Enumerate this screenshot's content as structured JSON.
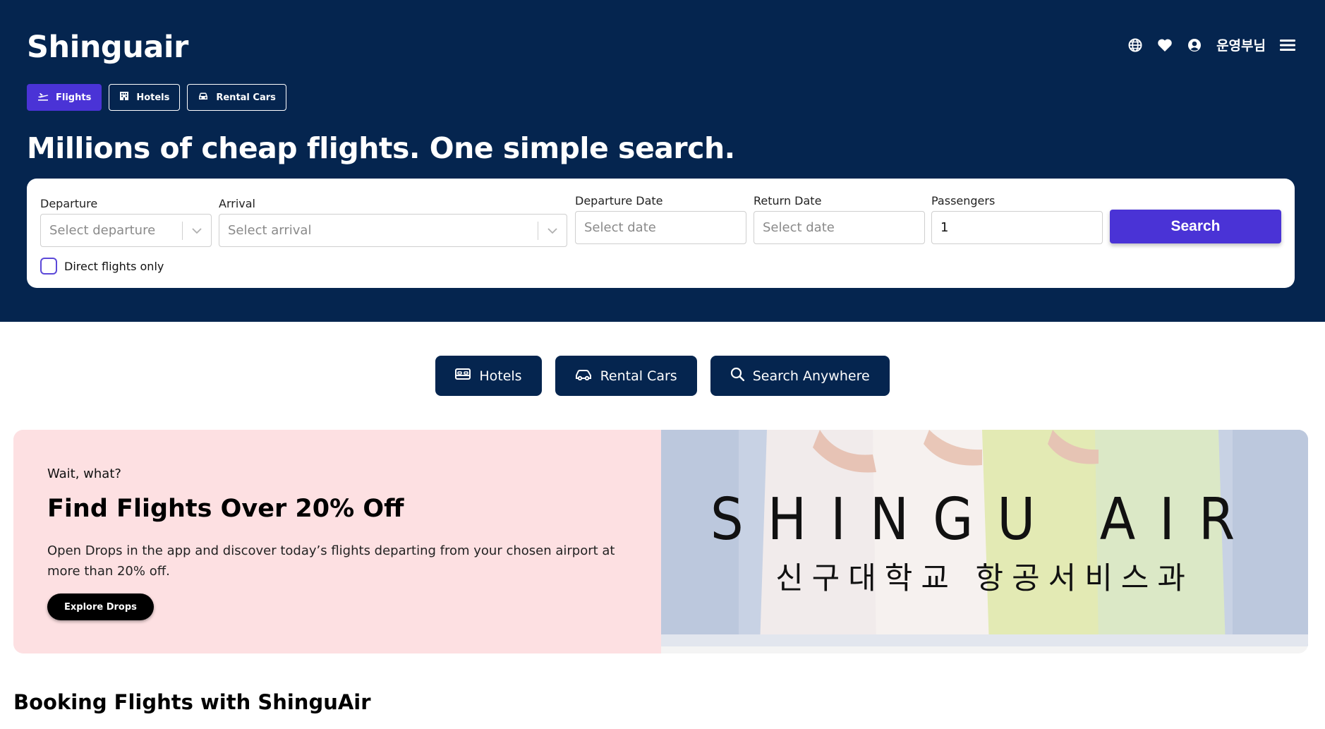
{
  "header": {
    "brand": "Shinguair",
    "user_name": "운영부님",
    "icons": [
      "globe-icon",
      "heart-icon",
      "user-circle-icon",
      "hamburger-menu-icon"
    ]
  },
  "mode_tabs": [
    {
      "label": "Flights",
      "icon": "plane-icon",
      "active": true
    },
    {
      "label": "Hotels",
      "icon": "building-icon",
      "active": false
    },
    {
      "label": "Rental Cars",
      "icon": "car-icon",
      "active": false
    }
  ],
  "headline": "Millions of cheap flights. One simple search.",
  "search": {
    "departure_label": "Departure",
    "departure_placeholder": "Select departure",
    "arrival_label": "Arrival",
    "arrival_placeholder": "Select arrival",
    "departure_date_label": "Departure Date",
    "departure_date_placeholder": "Select date",
    "return_date_label": "Return Date",
    "return_date_placeholder": "Select date",
    "passengers_label": "Passengers",
    "passengers_value": "1",
    "search_label": "Search",
    "direct_label": "Direct flights only",
    "direct_checked": false
  },
  "quick_links": [
    {
      "label": "Hotels",
      "icon": "bed-icon"
    },
    {
      "label": "Rental Cars",
      "icon": "car-icon"
    },
    {
      "label": "Search Anywhere",
      "icon": "search-icon"
    }
  ],
  "promo": {
    "kicker": "Wait, what?",
    "title": "Find Flights Over 20% Off",
    "description": "Open Drops in the app and discover today’s flights departing from your chosen airport at more than 20% off.",
    "button_label": "Explore Drops",
    "image_logo": "SHINGU AIR",
    "image_subtitle": "신구대학교 항공서비스과"
  },
  "section_title": "Booking Flights with ShinguAir",
  "colors": {
    "hero_bg": "#05254f",
    "accent": "#4a33d6",
    "promo_bg": "#fde0e2",
    "white": "#ffffff"
  }
}
